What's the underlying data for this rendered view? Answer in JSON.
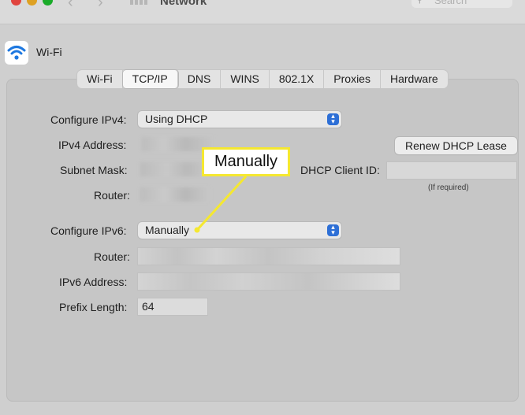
{
  "window": {
    "title": "Network",
    "search_placeholder": "Search",
    "traffic_lights": [
      "#e0443e",
      "#dea123",
      "#1aab29"
    ],
    "accent": "#2d6fd6",
    "callout_color": "#f5e830"
  },
  "service": {
    "name": "Wi-Fi",
    "icon": "wifi-icon"
  },
  "tabs": [
    {
      "label": "Wi-Fi"
    },
    {
      "label": "TCP/IP",
      "active": true
    },
    {
      "label": "DNS"
    },
    {
      "label": "WINS"
    },
    {
      "label": "802.1X"
    },
    {
      "label": "Proxies"
    },
    {
      "label": "Hardware"
    }
  ],
  "ipv4": {
    "configure_label": "Configure IPv4:",
    "configure_value": "Using DHCP",
    "address_label": "IPv4 Address:",
    "subnet_label": "Subnet Mask:",
    "router_label": "Router:",
    "renew_button": "Renew DHCP Lease",
    "client_id_label": "DHCP Client ID:",
    "client_id_note": "(If required)"
  },
  "ipv6": {
    "configure_label": "Configure IPv6:",
    "configure_value": "Manually",
    "router_label": "Router:",
    "address_label": "IPv6 Address:",
    "prefix_label": "Prefix Length:",
    "prefix_value": "64"
  },
  "callout": {
    "text": "Manually"
  }
}
